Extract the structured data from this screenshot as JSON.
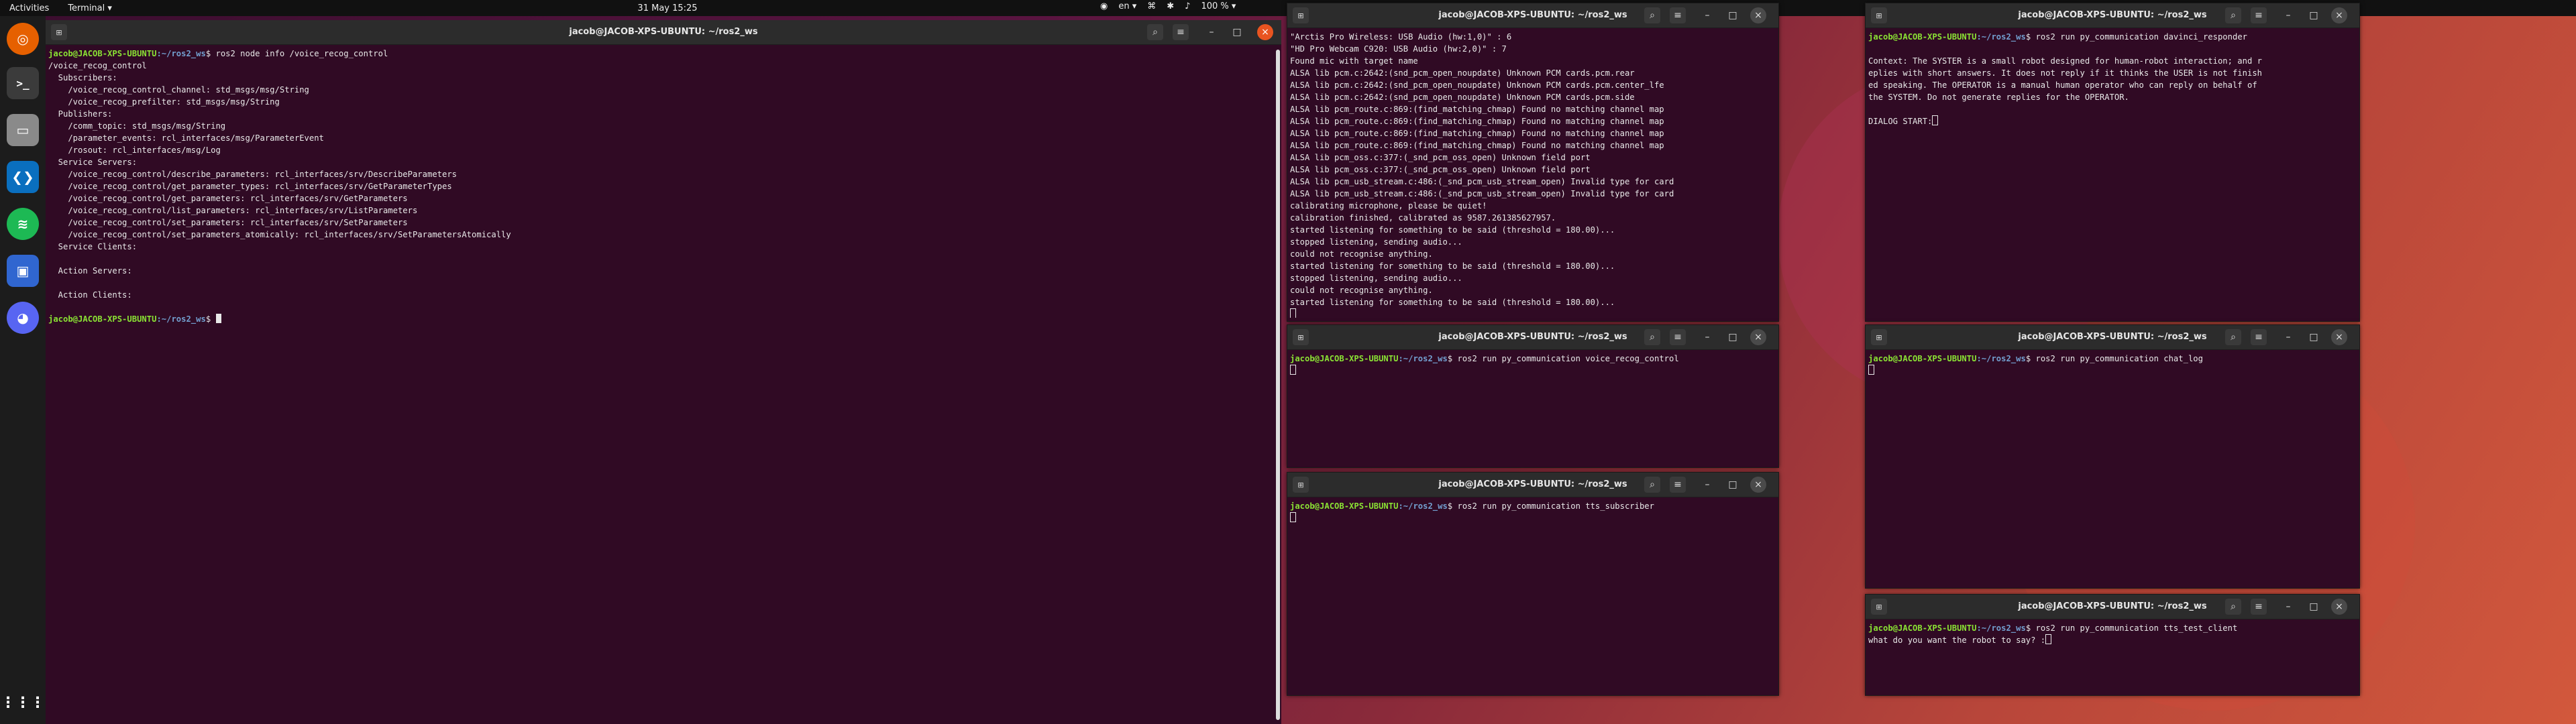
{
  "topbar": {
    "activities": "Activities",
    "app_menu": "Terminal ▾",
    "clock": "31 May  15:25",
    "lang": "en ▾",
    "battery": "100 % ▾"
  },
  "dock": {
    "items": [
      "terminal",
      "files",
      "vscode",
      "spotify",
      "screenshot",
      "discord"
    ]
  },
  "main_term": {
    "title": "jacob@JACOB-XPS-UBUNTU: ~/ros2_ws",
    "user": "jacob@JACOB-XPS-UBUNTU",
    "path": ":~/ros2_ws",
    "command": "$ ros2 node info /voice_recog_control",
    "output": [
      "/voice_recog_control",
      "  Subscribers:",
      "    /voice_recog_control_channel: std_msgs/msg/String",
      "    /voice_recog_prefilter: std_msgs/msg/String",
      "  Publishers:",
      "    /comm_topic: std_msgs/msg/String",
      "    /parameter_events: rcl_interfaces/msg/ParameterEvent",
      "    /rosout: rcl_interfaces/msg/Log",
      "  Service Servers:",
      "    /voice_recog_control/describe_parameters: rcl_interfaces/srv/DescribeParameters",
      "    /voice_recog_control/get_parameter_types: rcl_interfaces/srv/GetParameterTypes",
      "    /voice_recog_control/get_parameters: rcl_interfaces/srv/GetParameters",
      "    /voice_recog_control/list_parameters: rcl_interfaces/srv/ListParameters",
      "    /voice_recog_control/set_parameters: rcl_interfaces/srv/SetParameters",
      "    /voice_recog_control/set_parameters_atomically: rcl_interfaces/srv/SetParametersAtomically",
      "  Service Clients:",
      "",
      "  Action Servers:",
      "",
      "  Action Clients:",
      ""
    ],
    "final_prompt": "$ "
  },
  "audio_term": {
    "title": "jacob@JACOB-XPS-UBUNTU: ~/ros2_ws",
    "output": [
      "\"Arctis Pro Wireless: USB Audio (hw:1,0)\" : 6",
      "\"HD Pro Webcam C920: USB Audio (hw:2,0)\" : 7",
      "Found mic with target name",
      "ALSA lib pcm.c:2642:(snd_pcm_open_noupdate) Unknown PCM cards.pcm.rear",
      "ALSA lib pcm.c:2642:(snd_pcm_open_noupdate) Unknown PCM cards.pcm.center_lfe",
      "ALSA lib pcm.c:2642:(snd_pcm_open_noupdate) Unknown PCM cards.pcm.side",
      "ALSA lib pcm_route.c:869:(find_matching_chmap) Found no matching channel map",
      "ALSA lib pcm_route.c:869:(find_matching_chmap) Found no matching channel map",
      "ALSA lib pcm_route.c:869:(find_matching_chmap) Found no matching channel map",
      "ALSA lib pcm_route.c:869:(find_matching_chmap) Found no matching channel map",
      "ALSA lib pcm_oss.c:377:(_snd_pcm_oss_open) Unknown field port",
      "ALSA lib pcm_oss.c:377:(_snd_pcm_oss_open) Unknown field port",
      "ALSA lib pcm_usb_stream.c:486:(_snd_pcm_usb_stream_open) Invalid type for card",
      "ALSA lib pcm_usb_stream.c:486:(_snd_pcm_usb_stream_open) Invalid type for card",
      "calibrating microphone, please be quiet!",
      "calibration finished, calibrated as 9587.261385627957.",
      "started listening for something to be said (threshold = 180.00)...",
      "stopped listening, sending audio...",
      "could not recognise anything.",
      "started listening for something to be said (threshold = 180.00)...",
      "stopped listening, sending audio...",
      "could not recognise anything.",
      "started listening for something to be said (threshold = 180.00)..."
    ]
  },
  "voice_term": {
    "title": "jacob@JACOB-XPS-UBUNTU: ~/ros2_ws",
    "user": "jacob@JACOB-XPS-UBUNTU",
    "path": ":~/ros2_ws",
    "command": "$ ros2 run py_communication voice_recog_control"
  },
  "tts_term": {
    "title": "jacob@JACOB-XPS-UBUNTU: ~/ros2_ws",
    "user": "jacob@JACOB-XPS-UBUNTU",
    "path": ":~/ros2_ws",
    "command": "$ ros2 run py_communication tts_subscriber"
  },
  "davinci_term": {
    "title": "jacob@JACOB-XPS-UBUNTU: ~/ros2_ws",
    "user": "jacob@JACOB-XPS-UBUNTU",
    "path": ":~/ros2_ws",
    "command": "$ ros2 run py_communication davinci_responder",
    "output": [
      "",
      "Context: The SYSTER is a small robot designed for human-robot interaction; and r",
      "eplies with short answers. It does not reply if it thinks the USER is not finish",
      "ed speaking. The OPERATOR is a manual human operator who can reply on behalf of",
      "the SYSTEM. Do not generate replies for the OPERATOR.",
      ""
    ],
    "dialog": "DIALOG START:"
  },
  "chat_term": {
    "title": "jacob@JACOB-XPS-UBUNTU: ~/ros2_ws",
    "user": "jacob@JACOB-XPS-UBUNTU",
    "path": ":~/ros2_ws",
    "command": "$ ros2 run py_communication chat_log"
  },
  "client_term": {
    "title": "jacob@JACOB-XPS-UBUNTU: ~/ros2_ws",
    "user": "jacob@JACOB-XPS-UBUNTU",
    "path": ":~/ros2_ws",
    "command": "$ ros2 run py_communication tts_test_client",
    "question": "what do you want the robot to say? :"
  },
  "window_buttons": {
    "tab": "⊞",
    "search": "⌕",
    "menu": "≡",
    "minimize": "–",
    "maximize": "□",
    "close": "×"
  }
}
